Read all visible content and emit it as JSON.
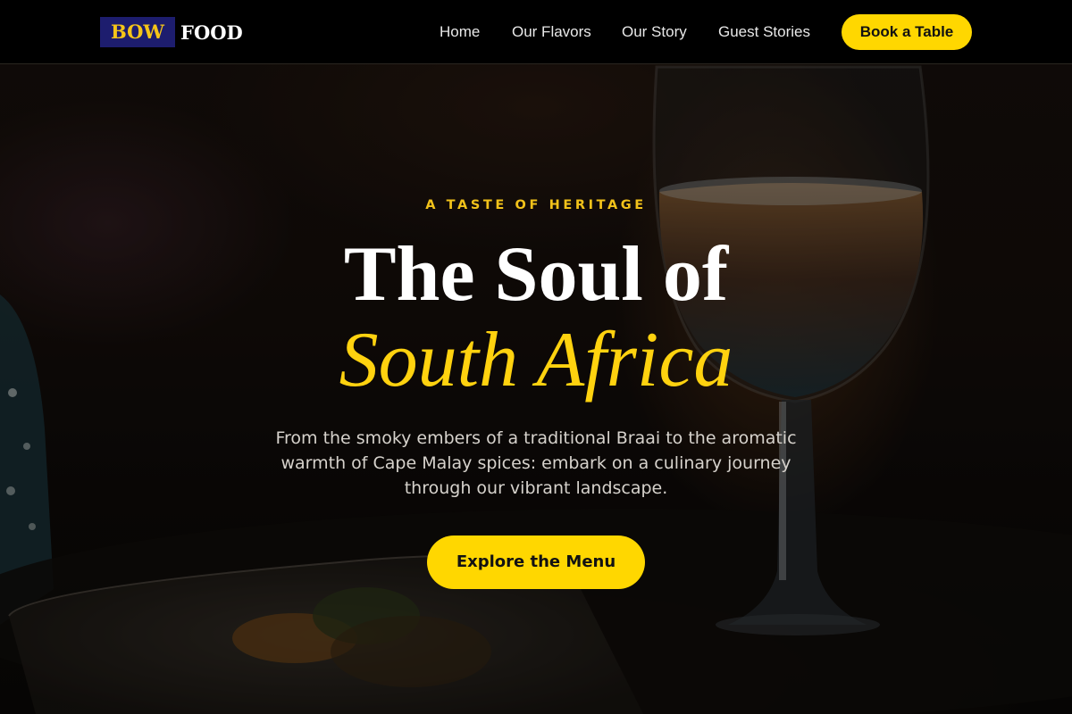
{
  "brand": {
    "mark": "BOW",
    "name": "FOOD"
  },
  "nav": {
    "items": [
      {
        "label": "Home"
      },
      {
        "label": "Our Flavors"
      },
      {
        "label": "Our Story"
      },
      {
        "label": "Guest Stories"
      }
    ],
    "cta_label": "Book a Table"
  },
  "hero": {
    "eyebrow": "A TASTE OF HERITAGE",
    "title_line1": "The Soul of",
    "title_line2": "South Africa",
    "subtitle": "From the smoky embers of a traditional Braai to the aromatic warmth of Cape Malay spices: embark on a culinary journey through our vibrant landscape.",
    "cta_label": "Explore the Menu",
    "background_image": "dim restaurant table with a wine glass and a plated dish"
  },
  "colors": {
    "accent": "#ffd700",
    "logo_mark_bg": "#1d1d6e",
    "header_bg": "#000000"
  }
}
